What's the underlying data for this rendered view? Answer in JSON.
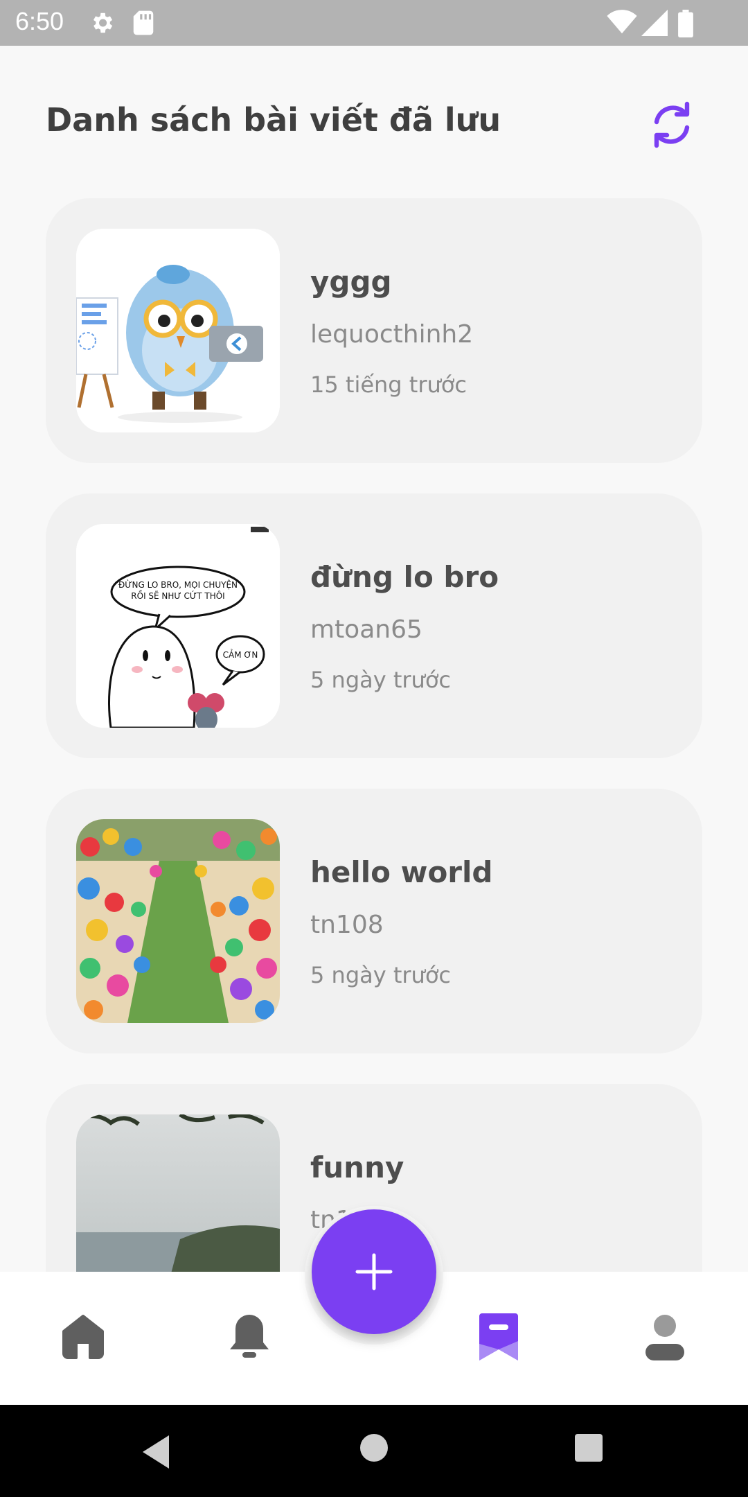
{
  "status_bar": {
    "time": "6:50"
  },
  "header": {
    "title": "Danh sách bài viết đã lưu",
    "refresh_icon": "refresh-icon"
  },
  "posts": [
    {
      "title": "yggg",
      "author": "lequocthinh2",
      "time": "15 tiếng trước"
    },
    {
      "title": "đừng lo bro",
      "author": "mtoan65",
      "time": "5 ngày trước"
    },
    {
      "title": "hello world",
      "author": "tn108",
      "time": "5 ngày trước"
    },
    {
      "title": "funny",
      "author": "tn1",
      "time": ""
    }
  ],
  "comic": {
    "speech_1": "ĐỪNG LO BRO, MỌI CHUYỆN RỒI SẼ NHƯ CỨT THÔI",
    "speech_2": "CẢM ƠN"
  },
  "bottom_nav": {
    "items": [
      "home-icon",
      "bell-icon",
      "bookmark-icon",
      "profile-icon"
    ],
    "active": "bookmark-icon",
    "fab_icon": "plus-icon"
  },
  "colors": {
    "accent": "#7b3ff2",
    "icon_inactive": "#5f5f5f"
  }
}
